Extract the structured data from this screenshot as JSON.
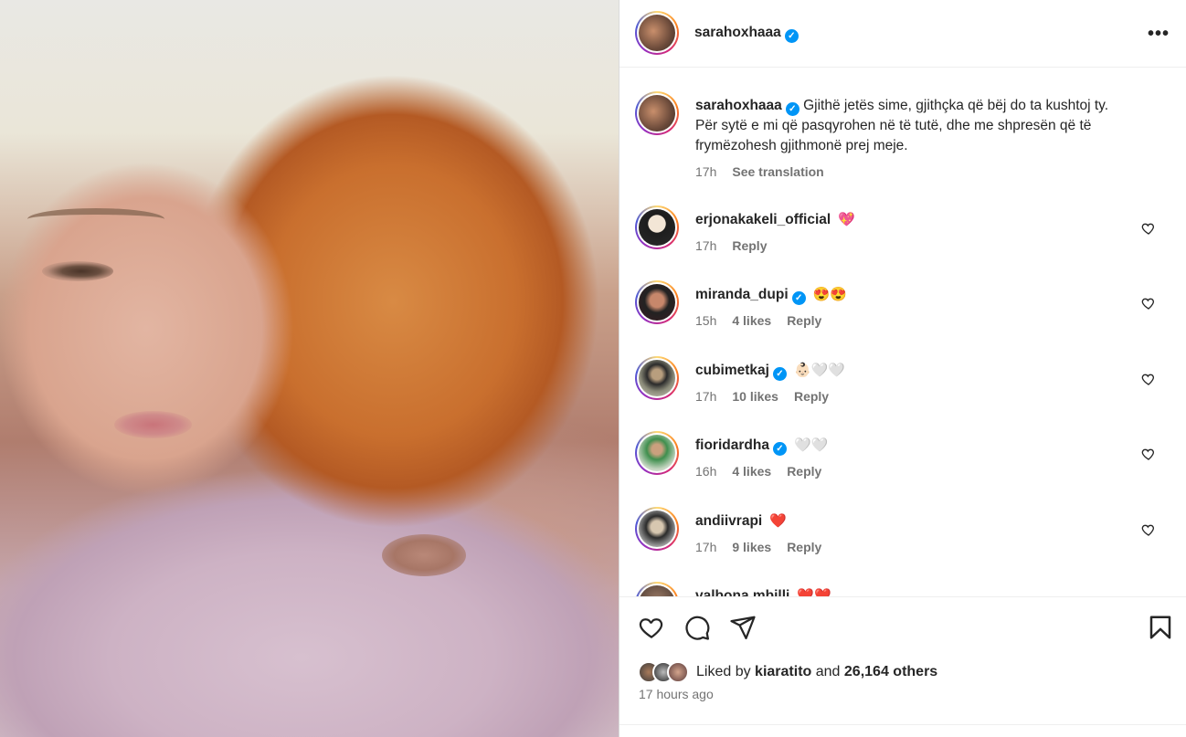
{
  "post": {
    "username": "sarahoxhaaa",
    "more_label": "•••",
    "caption": "Gjithë jetës sime, gjithçka që bëj do ta kushtoj ty. Për sytë e mi që pasqyrohen në të tutë, dhe me shpresën që të frymëzohesh gjithmonë prej meje.",
    "caption_time": "17h",
    "see_translation": "See translation"
  },
  "comments": [
    {
      "username": "erjonakakeli_official",
      "verified": false,
      "emoji": "💖",
      "time": "17h",
      "likes": "",
      "reply": "Reply"
    },
    {
      "username": "miranda_dupi",
      "verified": true,
      "emoji": "😍😍",
      "time": "15h",
      "likes": "4 likes",
      "reply": "Reply"
    },
    {
      "username": "cubimetkaj",
      "verified": true,
      "emoji": "👶🏻🤍🤍",
      "time": "17h",
      "likes": "10 likes",
      "reply": "Reply"
    },
    {
      "username": "fioridardha",
      "verified": true,
      "emoji": "🤍🤍",
      "time": "16h",
      "likes": "4 likes",
      "reply": "Reply"
    },
    {
      "username": "andiivrapi",
      "verified": false,
      "emoji": "❤️",
      "time": "17h",
      "likes": "9 likes",
      "reply": "Reply"
    },
    {
      "username": "valbona.mbilli",
      "verified": false,
      "emoji": "❤️❤️",
      "time": "",
      "likes": "",
      "reply": ""
    }
  ],
  "likes_summary": {
    "prefix": "Liked by",
    "user": "kiaratito",
    "and": "and",
    "others": "26,164 others"
  },
  "time_ago": "17 hours ago",
  "colors": {
    "verified": "#0095f6",
    "muted": "#737373",
    "text": "#262626",
    "heart_red": "#e0245e"
  },
  "icons": [
    "more-options-icon",
    "heart-icon",
    "comment-icon",
    "share-icon",
    "save-icon",
    "verified-badge-icon"
  ]
}
